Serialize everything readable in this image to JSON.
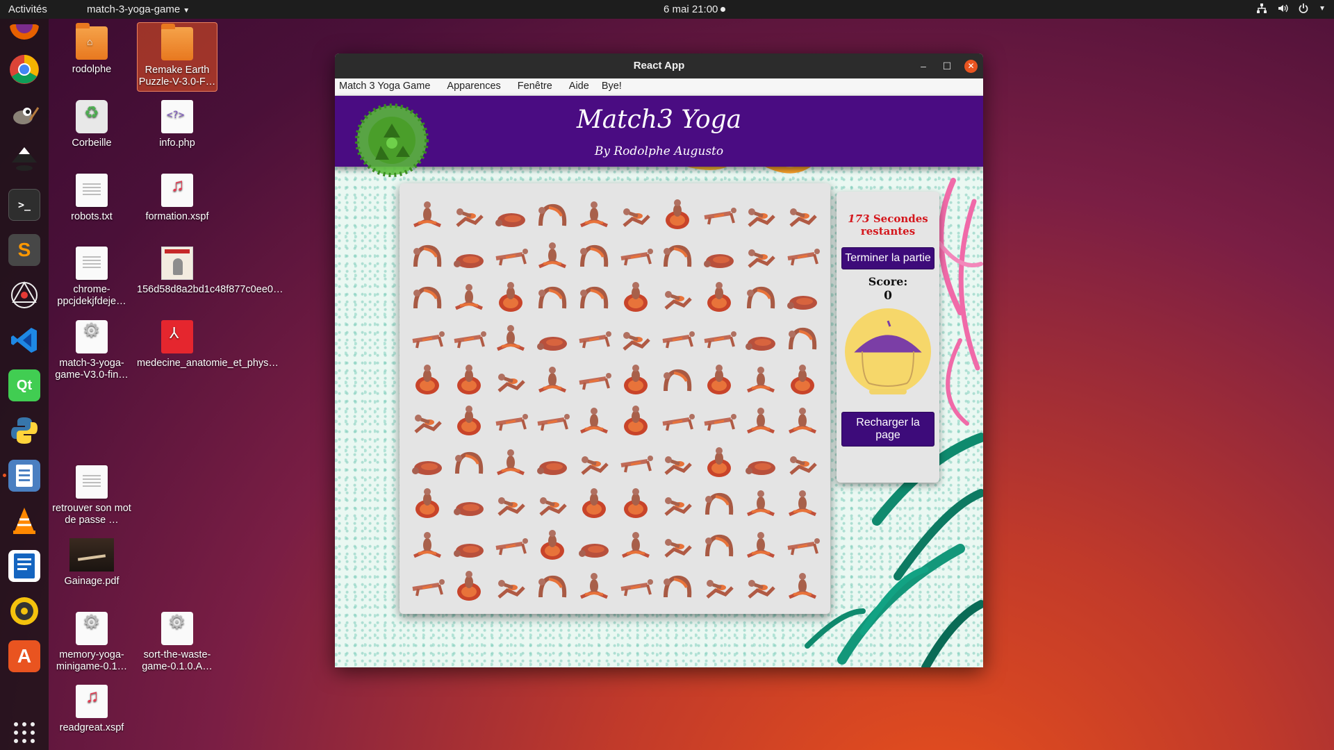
{
  "topbar": {
    "activities": "Activités",
    "app_menu": "match-3-yoga-game",
    "clock": "6 mai  21:00"
  },
  "dock": {
    "items": [
      "firefox-icon",
      "chrome-icon",
      "gimp-icon",
      "inkscape-icon",
      "terminal-icon",
      "sublime-text-icon",
      "network-tool-icon",
      "vscode-icon",
      "qt-creator-icon",
      "python-icon",
      "files-icon",
      "vlc-icon",
      "writer-icon",
      "rhythmbox-icon",
      "software-center-icon",
      "apps-grid-icon"
    ]
  },
  "desktop": {
    "icons": [
      {
        "label": "rodolphe",
        "kind": "home-folder"
      },
      {
        "label": "Remake Earth Puzzle-V-3.0-F…",
        "kind": "folder"
      },
      {
        "label": "Corbeille",
        "kind": "trash"
      },
      {
        "label": "info.php",
        "kind": "php"
      },
      {
        "label": "robots.txt",
        "kind": "text"
      },
      {
        "label": "formation.xspf",
        "kind": "playlist"
      },
      {
        "label": "chrome-ppcjdekjfdeje…",
        "kind": "text"
      },
      {
        "label": "156d58d8a2bd1c48f877c0ee0…",
        "kind": "image"
      },
      {
        "label": "match-3-yoga-game-V3.0-fin…",
        "kind": "package"
      },
      {
        "label": "medecine_anatomie_et_phys…",
        "kind": "pdf"
      },
      {
        "label": "retrouver son mot de passe …",
        "kind": "text"
      },
      {
        "label": "Gainage.pdf",
        "kind": "pdf-image"
      },
      {
        "label": "memory-yoga-minigame-0.1…",
        "kind": "package"
      },
      {
        "label": "sort-the-waste-game-0.1.0.A…",
        "kind": "package"
      },
      {
        "label": "readgreat.xspf",
        "kind": "playlist"
      }
    ]
  },
  "window": {
    "title": "React App",
    "menu": [
      "Match 3 Yoga Game",
      "Apparences",
      "Fenêtre",
      "Aide",
      "Bye!"
    ]
  },
  "app": {
    "title": "Match3 Yoga",
    "subtitle": "By Rodolphe Augusto",
    "timer_value": "173",
    "timer_text": "Secondes restantes",
    "end_button": "Terminer la partie",
    "score_label": "Score:",
    "score_value": "0",
    "reload_button": "Recharger la page",
    "grid_rows": [
      [
        "seated",
        "lunge",
        "childpose",
        "wheel",
        "seated",
        "lunge",
        "lotus",
        "plank",
        "lunge",
        "lunge"
      ],
      [
        "wheel",
        "childpose",
        "plank",
        "seated",
        "wheel",
        "plank",
        "wheel",
        "childpose",
        "lunge",
        "plank"
      ],
      [
        "wheel",
        "seated",
        "lotus",
        "wheel",
        "wheel",
        "lotus",
        "lunge",
        "lotus",
        "wheel",
        "childpose"
      ],
      [
        "plank",
        "plank",
        "seated",
        "childpose",
        "plank",
        "lunge",
        "plank",
        "plank",
        "childpose",
        "wheel"
      ],
      [
        "lotus",
        "lotus",
        "lunge",
        "seated",
        "plank",
        "lotus",
        "wheel",
        "lotus",
        "seated",
        "lotus"
      ],
      [
        "lunge",
        "lotus",
        "plank",
        "plank",
        "seated",
        "lotus",
        "plank",
        "plank",
        "seated",
        "seated"
      ],
      [
        "childpose",
        "wheel",
        "seated",
        "childpose",
        "lunge",
        "plank",
        "lunge",
        "lotus",
        "childpose",
        "lunge"
      ],
      [
        "lotus",
        "childpose",
        "lunge",
        "lunge",
        "lotus",
        "lotus",
        "lunge",
        "wheel",
        "seated",
        "seated"
      ],
      [
        "seated",
        "childpose",
        "plank",
        "lotus",
        "childpose",
        "seated",
        "lunge",
        "wheel",
        "seated",
        "plank"
      ],
      [
        "plank",
        "lotus",
        "lunge",
        "wheel",
        "seated",
        "plank",
        "wheel",
        "lunge",
        "lunge",
        "seated"
      ]
    ],
    "colors": {
      "header": "#4a0c82",
      "button": "#3d0b7a",
      "timer": "#d4161c"
    }
  }
}
